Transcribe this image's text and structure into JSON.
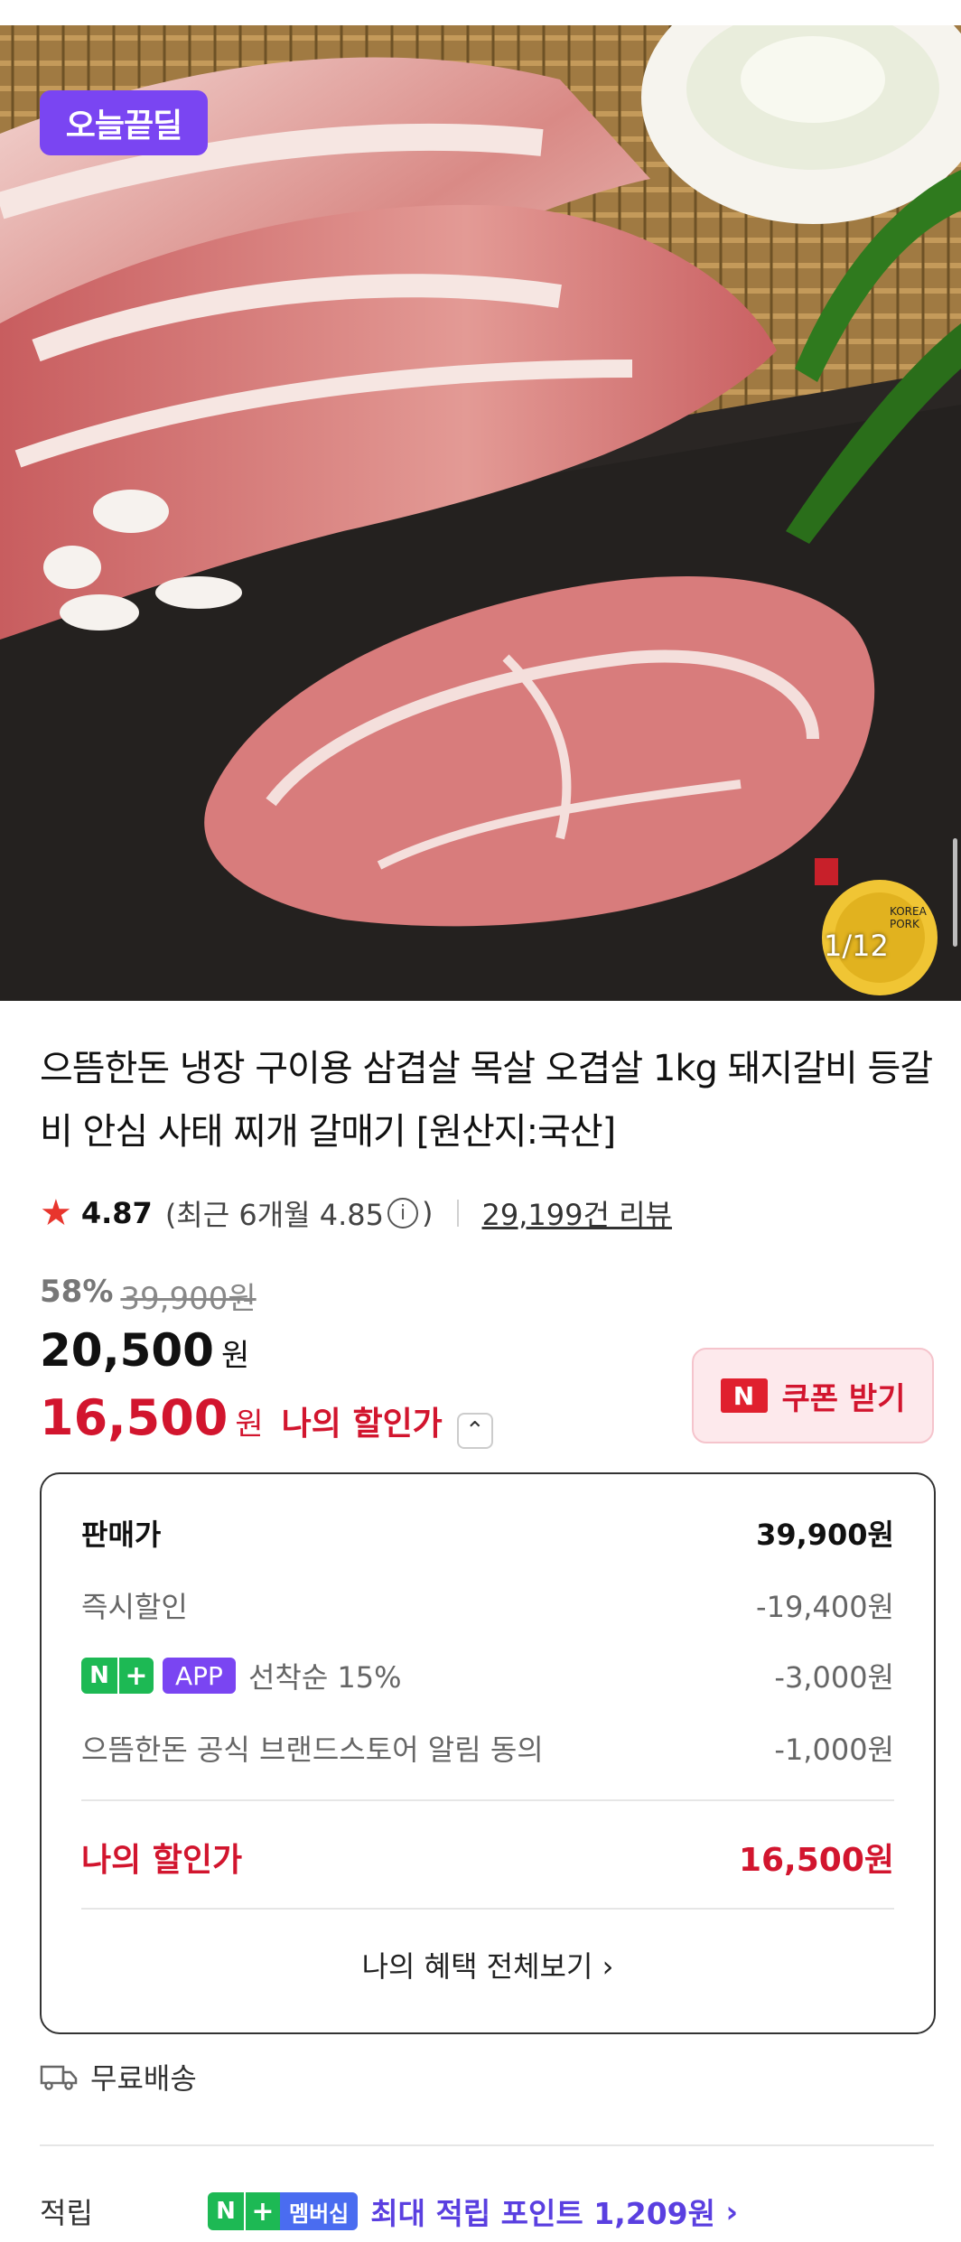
{
  "hero": {
    "badge": "오늘끝딜",
    "image_counter": "1/12"
  },
  "product": {
    "title": "으뜸한돈 냉장 구이용 삼겹살 목살 오겹살 1kg 돼지갈비 등갈비 안심 사태 찌개 갈매기 [원산지:국산]",
    "rating": "4.87",
    "recent_rating": "(최근 6개월 4.85",
    "recent_close": ")",
    "reviews": "29,199건 리뷰"
  },
  "price": {
    "discount_rate": "58%",
    "original": "39,900원",
    "sale": "20,500",
    "sale_unit": "원",
    "my_price": "16,500",
    "my_price_unit": "원",
    "my_price_label": "나의 할인가",
    "coupon_label": "쿠폰 받기"
  },
  "benefits": {
    "rows": [
      {
        "label": "판매가",
        "value": "39,900원"
      },
      {
        "label": "즉시할인",
        "value": "-19,400원"
      },
      {
        "label": "선착순 15%",
        "value": "-3,000원",
        "badge": "APP"
      },
      {
        "label": "으뜸한돈 공식 브랜드스토어 알림 동의",
        "value": "-1,000원"
      }
    ],
    "total_label": "나의 할인가",
    "total_value": "16,500원",
    "view_all": "나의 혜택 전체보기"
  },
  "shipping": {
    "label": "무료배송"
  },
  "points": {
    "label": "적립",
    "member": "멤버십",
    "value": "최대 적립 포인트 1,209원"
  },
  "colors": {
    "accent_red": "#d2152e",
    "badge_purple": "#7a45f2",
    "naver_green": "#1db954"
  }
}
